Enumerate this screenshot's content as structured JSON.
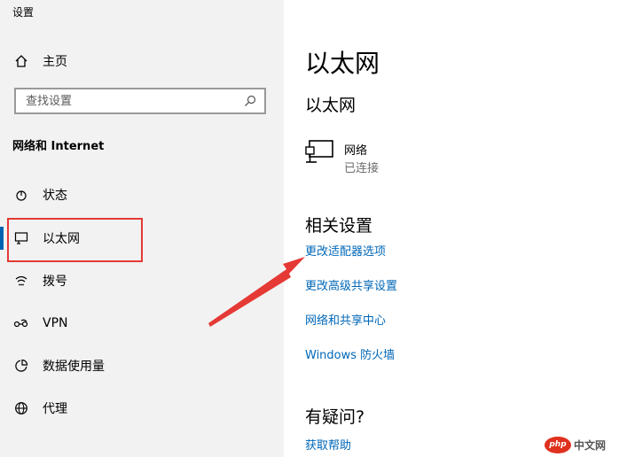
{
  "window": {
    "title": "设置"
  },
  "sidebar": {
    "home": {
      "label": "主页",
      "icon": "home-icon"
    },
    "search": {
      "placeholder": "查找设置",
      "icon": "search-icon"
    },
    "section_title": "网络和 Internet",
    "items": [
      {
        "label": "状态",
        "icon": "status-icon"
      },
      {
        "label": "以太网",
        "icon": "ethernet-icon",
        "selected": true
      },
      {
        "label": "拨号",
        "icon": "dialup-icon"
      },
      {
        "label": "VPN",
        "icon": "vpn-icon"
      },
      {
        "label": "数据使用量",
        "icon": "data-usage-icon"
      },
      {
        "label": "代理",
        "icon": "globe-icon"
      }
    ]
  },
  "main": {
    "title": "以太网",
    "subtitle": "以太网",
    "network": {
      "name": "网络",
      "status": "已连接",
      "icon": "network-adapter-icon"
    },
    "related_title": "相关设置",
    "links": [
      "更改适配器选项",
      "更改高级共享设置",
      "网络和共享中心",
      "Windows 防火墙"
    ],
    "help_title": "有疑问?",
    "help_link": "获取帮助"
  },
  "annotations": {
    "highlight_color": "#e53935",
    "arrow_color": "#e53935"
  },
  "watermark": {
    "badge": "php",
    "text": "中文网"
  },
  "colors": {
    "accent": "#0063b1",
    "link": "#0067b8",
    "sidebar_bg": "#f2f2f2"
  }
}
